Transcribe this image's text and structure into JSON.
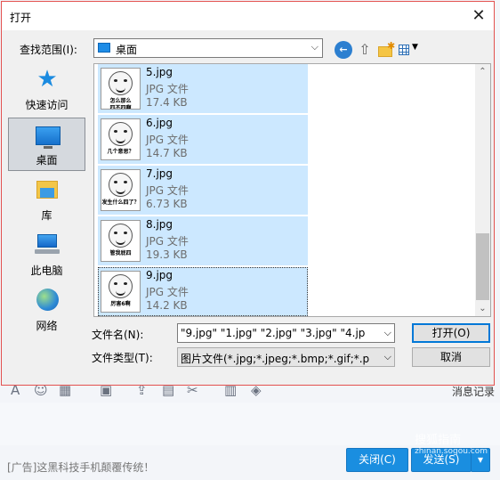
{
  "dialog": {
    "title": "打开",
    "look_in_label": "查找范围(I):",
    "look_in_value": "桌面",
    "places": [
      {
        "label": "快速访问"
      },
      {
        "label": "桌面"
      },
      {
        "label": "库"
      },
      {
        "label": "此电脑"
      },
      {
        "label": "网络"
      }
    ],
    "files": [
      {
        "name": "5.jpg",
        "type": "JPG 文件",
        "size": "17.4 KB",
        "caption": "怎么那么\n四不四啊"
      },
      {
        "name": "6.jpg",
        "type": "JPG 文件",
        "size": "14.7 KB",
        "caption": "几个意思？"
      },
      {
        "name": "7.jpg",
        "type": "JPG 文件",
        "size": "6.73 KB",
        "caption": "发生什么四了？"
      },
      {
        "name": "8.jpg",
        "type": "JPG 文件",
        "size": "19.3 KB",
        "caption": "管我屁四"
      },
      {
        "name": "9.jpg",
        "type": "JPG 文件",
        "size": "14.2 KB",
        "caption": "厉害6啊"
      }
    ],
    "filename_label": "文件名(N):",
    "filename_value": "\"9.jpg\" \"1.jpg\" \"2.jpg\" \"3.jpg\" \"4.jp",
    "filetype_label": "文件类型(T):",
    "filetype_value": "图片文件(*.jpg;*.jpeg;*.bmp;*.gif;*.p",
    "open_button": "打开(O)",
    "cancel_button": "取消"
  },
  "background": {
    "history_label": "消息记录",
    "ad_text": "[广告]这黑科技手机颠覆传统！",
    "close_button": "关闭(C)",
    "send_button": "发送(S)",
    "watermark": "搜狐指南",
    "watermark_sub": "zhinan.sogou.com"
  }
}
